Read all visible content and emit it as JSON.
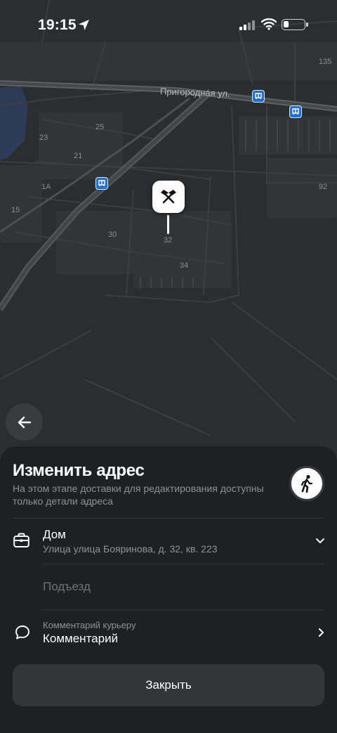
{
  "status_bar": {
    "time": "19:15"
  },
  "map": {
    "street": "Пригородная ул.",
    "house_numbers": [
      "135",
      "25",
      "23",
      "21",
      "1А",
      "15",
      "30",
      "32",
      "34",
      "92"
    ]
  },
  "sheet": {
    "title": "Изменить адрес",
    "subtitle": "На этом этапе доставки для редактирования доступны только детали адреса",
    "address": {
      "title": "Дом",
      "line": "Улица улица Бояринова, д. 32, кв. 223"
    },
    "entrance_placeholder": "Подъезд",
    "comment": {
      "label": "Комментарий курьеру",
      "value": "Комментарий"
    },
    "close_label": "Закрыть"
  },
  "icons": {
    "location_arrow": "location-arrow-icon",
    "back": "arrow-left-icon",
    "walk": "walking-person-icon",
    "briefcase": "briefcase-icon",
    "comment": "speech-bubble-icon",
    "chevron_down": "chevron-down-icon",
    "chevron_right": "chevron-right-icon",
    "pin": "crossed-hammers-icon",
    "transit": "bus-stop-icon"
  },
  "colors": {
    "map_bg": "#2c2d2e",
    "sheet_bg": "#1f2021",
    "transit_blue": "#1f6fd6"
  }
}
